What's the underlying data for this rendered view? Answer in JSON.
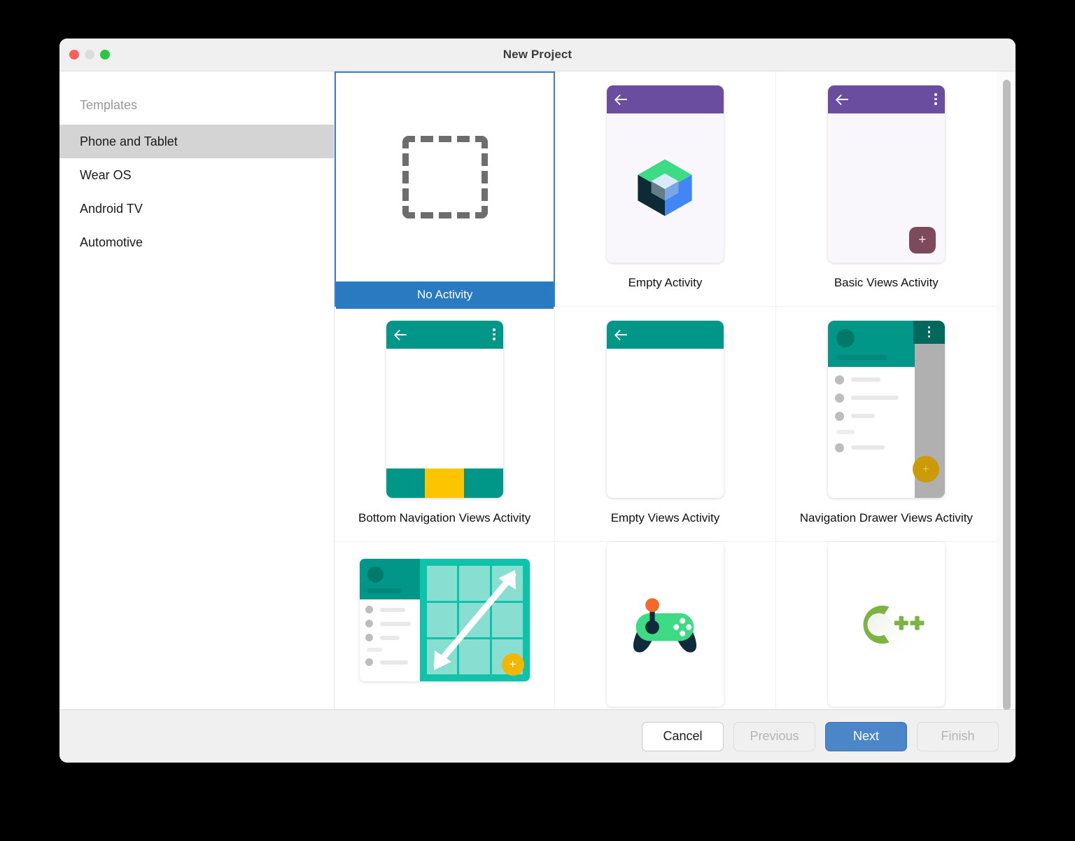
{
  "window": {
    "title": "New Project",
    "traffic_lights": [
      "close-red",
      "minimize-gray",
      "zoom-green"
    ]
  },
  "sidebar": {
    "header": "Templates",
    "items": [
      {
        "label": "Phone and Tablet",
        "selected": true
      },
      {
        "label": "Wear OS",
        "selected": false
      },
      {
        "label": "Android TV",
        "selected": false
      },
      {
        "label": "Automotive",
        "selected": false
      }
    ]
  },
  "templates": [
    {
      "label": "No Activity",
      "selected": true
    },
    {
      "label": "Empty Activity",
      "selected": false
    },
    {
      "label": "Basic Views Activity",
      "selected": false
    },
    {
      "label": "Bottom Navigation Views Activity",
      "selected": false
    },
    {
      "label": "Empty Views Activity",
      "selected": false
    },
    {
      "label": "Navigation Drawer Views Activity",
      "selected": false
    },
    {
      "label": "",
      "selected": false
    },
    {
      "label": "",
      "selected": false
    },
    {
      "label": "",
      "selected": false
    }
  ],
  "footer": {
    "cancel": "Cancel",
    "previous": "Previous",
    "next": "Next",
    "finish": "Finish"
  },
  "colors": {
    "accent_blue": "#2a7ac2",
    "selection_border": "#3b7dd8",
    "primary_button": "#4a86c8",
    "teal": "#009688",
    "purple": "#6a4d9e",
    "yellow": "#fdc500",
    "sidebar_selected": "#d4d4d4"
  }
}
